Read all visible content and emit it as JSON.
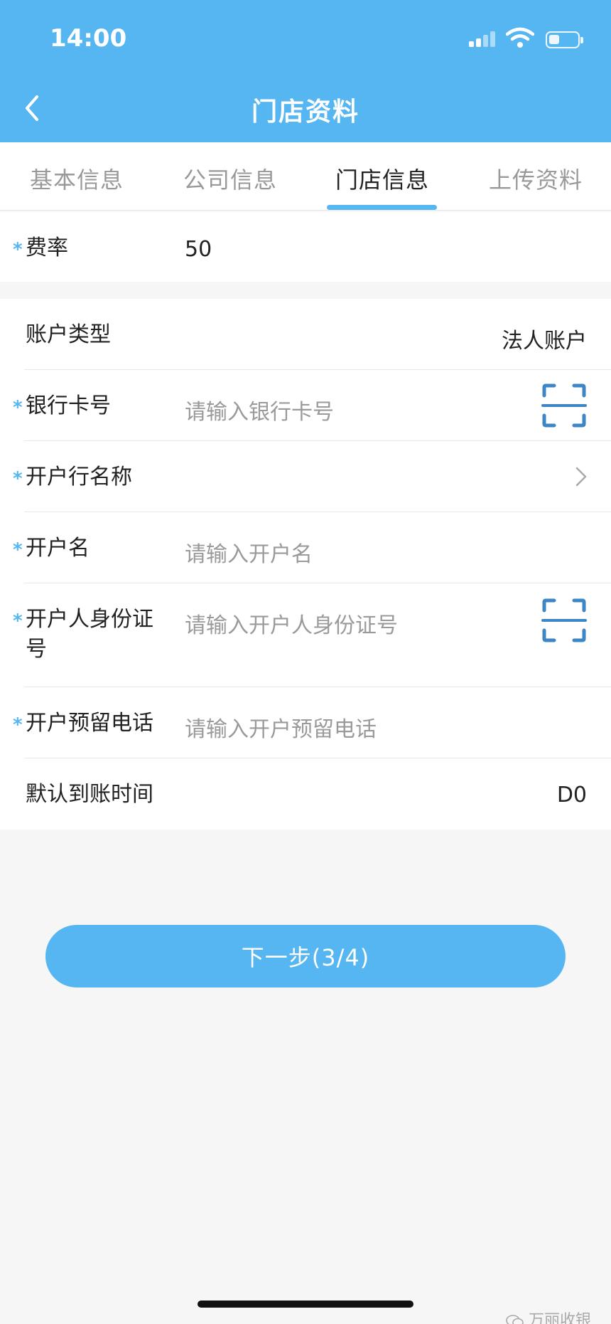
{
  "status_bar": {
    "time": "14:00"
  },
  "header": {
    "title": "门店资料",
    "back_icon": "chevron-left-icon"
  },
  "tabs": [
    {
      "label": "基本信息",
      "active": false
    },
    {
      "label": "公司信息",
      "active": false
    },
    {
      "label": "门店信息",
      "active": true
    },
    {
      "label": "上传资料",
      "active": false
    }
  ],
  "form": {
    "required_mark": "*",
    "rate": {
      "label": "费率",
      "value": "50",
      "required": true
    },
    "account_type": {
      "label": "账户类型",
      "value": "法人账户",
      "required": false
    },
    "bank_card": {
      "label": "银行卡号",
      "placeholder": "请输入银行卡号",
      "required": true,
      "icon": "scan-icon"
    },
    "bank_name": {
      "label": "开户行名称",
      "required": true,
      "icon": "chevron-right-icon"
    },
    "account_name": {
      "label": "开户名",
      "placeholder": "请输入开户名",
      "required": true
    },
    "holder_id": {
      "label_line1": "开户人身份证",
      "label_line2": "号",
      "placeholder": "请输入开户人身份证号",
      "required": true,
      "icon": "scan-icon"
    },
    "reserved_phone": {
      "label": "开户预留电话",
      "placeholder": "请输入开户预留电话",
      "required": true
    },
    "settlement_time": {
      "label": "默认到账时间",
      "value": "D0",
      "required": false
    }
  },
  "next_button": {
    "label": "下一步(3/4)"
  },
  "watermark": {
    "text": "万丽收银"
  },
  "colors": {
    "primary": "#56b6f2",
    "background": "#f6f6f6",
    "scan_icon": "#3d86c6"
  }
}
